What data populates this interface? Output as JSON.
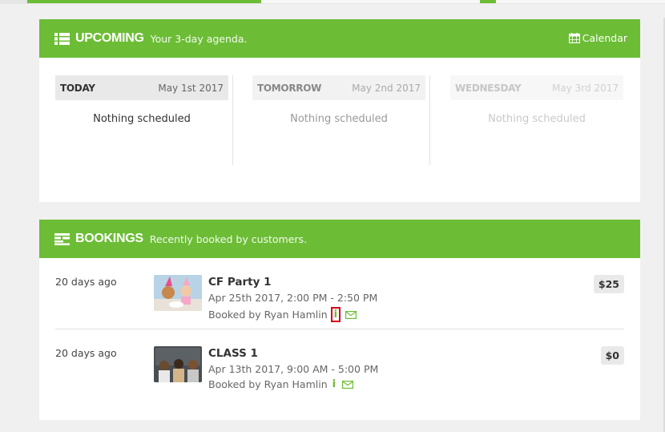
{
  "upcoming": {
    "title": "UPCOMING",
    "subtitle": "Your 3-day agenda.",
    "calendar_label": "Calendar",
    "days": [
      {
        "name": "TODAY",
        "date": "May 1st 2017",
        "empty": "Nothing scheduled"
      },
      {
        "name": "TOMORROW",
        "date": "May 2nd 2017",
        "empty": "Nothing scheduled"
      },
      {
        "name": "WEDNESDAY",
        "date": "May 3rd 2017",
        "empty": "Nothing scheduled"
      }
    ]
  },
  "bookings": {
    "title": "BOOKINGS",
    "subtitle": "Recently booked by customers.",
    "items": [
      {
        "ago": "20 days ago",
        "name": "CF Party 1",
        "time": "Apr 25th 2017, 2:00 PM - 2:50 PM",
        "booked_by": "Booked by Ryan Hamlin",
        "price": "$25",
        "info_icon": "i"
      },
      {
        "ago": "20 days ago",
        "name": "CLASS 1",
        "time": "Apr 13th 2017, 9:00 AM - 5:00 PM",
        "booked_by": "Booked by Ryan Hamlin",
        "price": "$0",
        "info_icon": "i"
      }
    ]
  },
  "colors": {
    "accent": "#6cbd35",
    "highlight": "#d0021b"
  },
  "icons": [
    "list-icon",
    "calendar-icon",
    "bookings-icon",
    "info-icon",
    "envelope-icon"
  ]
}
